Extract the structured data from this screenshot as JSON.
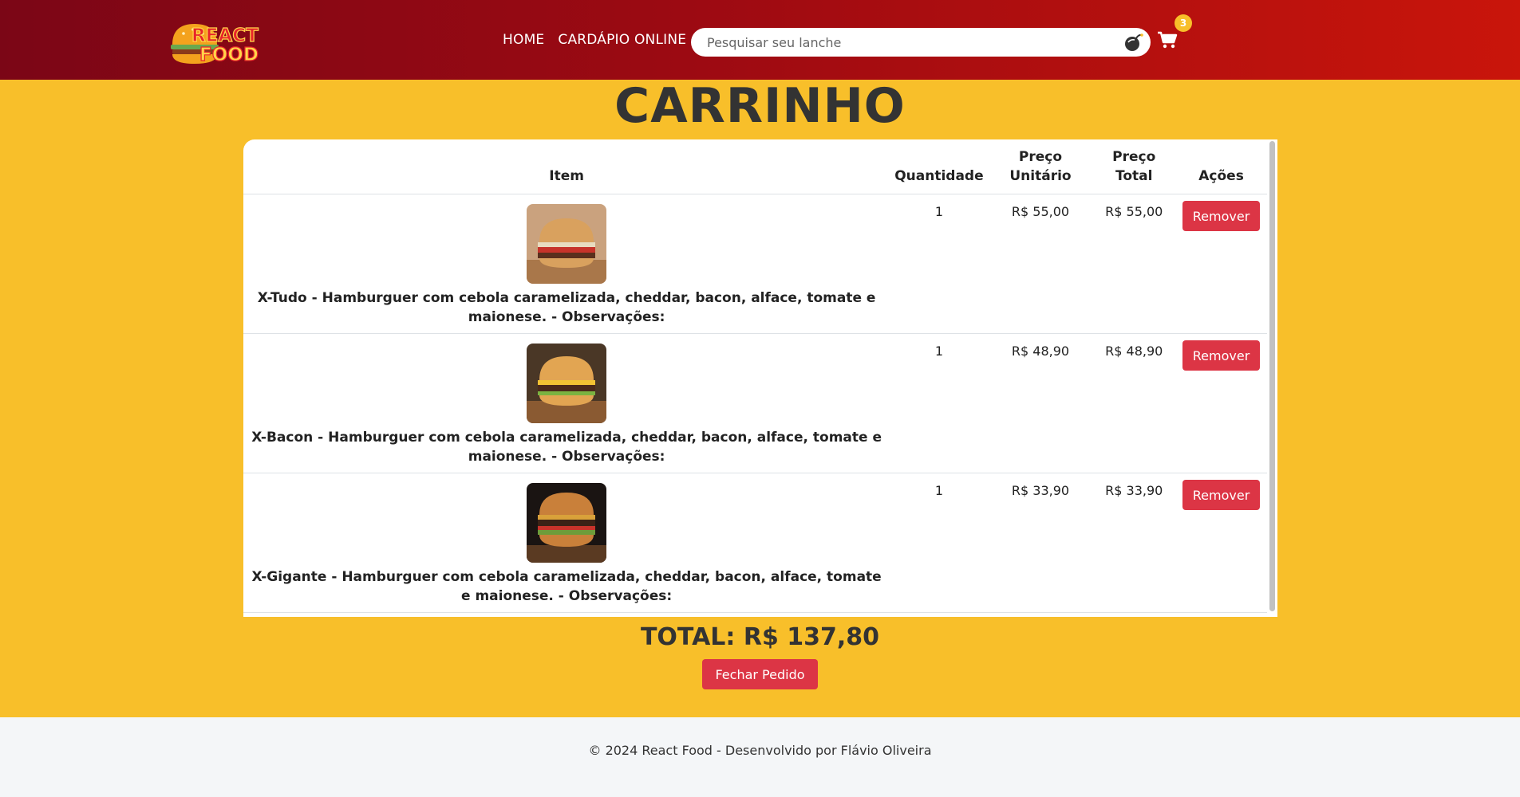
{
  "header": {
    "logo_text": "REACT FOOD",
    "nav": [
      "HOME",
      "CARDÁPIO ONLINE"
    ],
    "search_placeholder": "Pesquisar seu lanche",
    "cart_count": "3"
  },
  "page": {
    "title": "CARRINHO"
  },
  "table": {
    "headers": {
      "item": "Item",
      "quantity": "Quantidade",
      "unit_price": "Preço Unitário",
      "total_price": "Preço Total",
      "actions": "Ações"
    },
    "rows": [
      {
        "description": "X-Tudo - Hamburguer com cebola caramelizada, cheddar, bacon, alface, tomate e maionese. - Observações:",
        "quantity": "1",
        "unit_price": "R$ 55,00",
        "total_price": "R$ 55,00",
        "action": "Remover"
      },
      {
        "description": "X-Bacon - Hamburguer com cebola caramelizada, cheddar, bacon, alface, tomate e maionese. - Observações:",
        "quantity": "1",
        "unit_price": "R$ 48,90",
        "total_price": "R$ 48,90",
        "action": "Remover"
      },
      {
        "description": "X-Gigante - Hamburguer com cebola caramelizada, cheddar, bacon, alface, tomate e maionese. - Observações:",
        "quantity": "1",
        "unit_price": "R$ 33,90",
        "total_price": "R$ 33,90",
        "action": "Remover"
      }
    ]
  },
  "summary": {
    "total": "TOTAL: R$ 137,80",
    "checkout_label": "Fechar Pedido"
  },
  "footer": {
    "text": "© 2024 React Food - Desenvolvido por Flávio Oliveira"
  },
  "colors": {
    "header_dark": "#7b0616",
    "header_light": "#c9150b",
    "background": "#f8bf2a",
    "danger": "#dc3545",
    "footer_bg": "#f4f6f8"
  }
}
